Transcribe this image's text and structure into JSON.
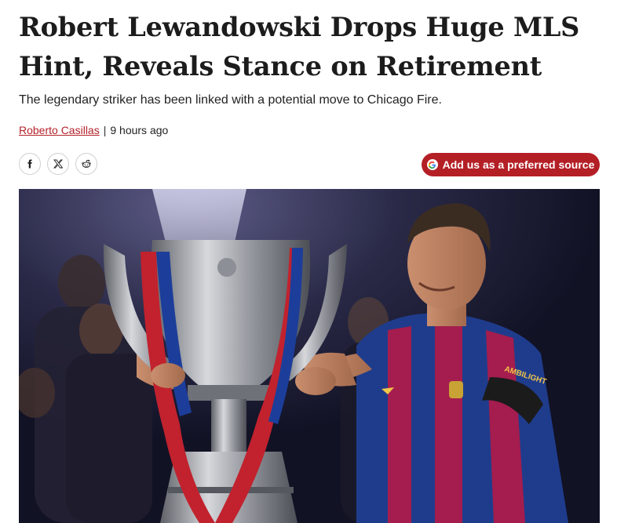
{
  "article": {
    "headline": "Robert Lewandowski Drops Huge MLS Hint, Reveals Stance on Retirement",
    "subheadline": "The legendary striker has been linked with a potential move to Chicago Fire.",
    "author": "Roberto Casillas",
    "separator": "|",
    "published": "9 hours ago"
  },
  "share": {
    "items": [
      {
        "icon": "facebook-icon"
      },
      {
        "icon": "x-icon"
      },
      {
        "icon": "reddit-icon"
      }
    ]
  },
  "preferred_source": {
    "label": "Add us as a preferred source",
    "icon": "google-icon",
    "color": "#b41f26"
  },
  "hero_image": {
    "shirt_sponsor_text": "AMBILIGHT"
  }
}
